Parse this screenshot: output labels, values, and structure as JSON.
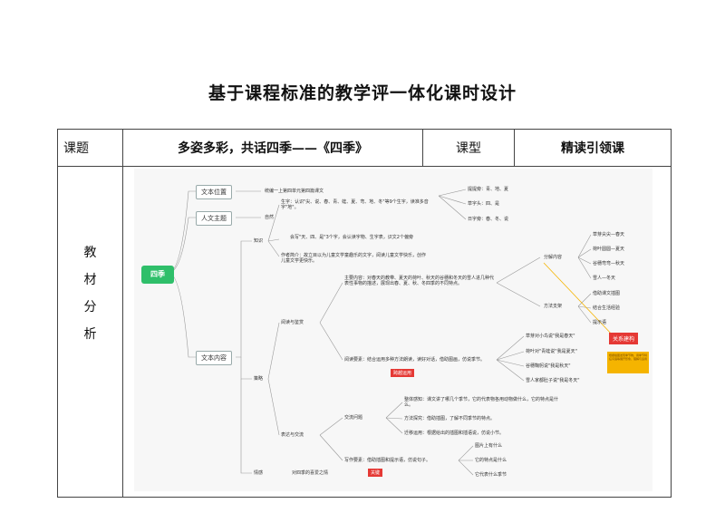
{
  "doc": {
    "title": "基于课程标准的教学评一体化课时设计",
    "lesson_label": "课题",
    "lesson_value": "多姿多彩，共话四季——《四季》",
    "type_label": "课型",
    "type_value": "精读引领课",
    "analysis_label_chars": [
      "教",
      "材",
      "分",
      "析"
    ]
  },
  "mindmap": {
    "root": "四季",
    "branch1": "文本位置",
    "branch1_note": "统编一上第四单元第四篇课文",
    "branch2": "人文主题",
    "branch2_note": "自然",
    "branch3": "文本内容",
    "knowledge": "知识",
    "char_note": "生字：认识\"尖、说、春、青、蛙、夏、弯、地、冬\"等9个生字，读准多音字\"地\"。",
    "radicals": [
      "提提旁：青、地、夏",
      "草字头：四、是",
      "日字旁：春、冬、说"
    ],
    "write_note": "会写\"天、四、是\"3个字，会认读字物、生字表，识文2个偏旁",
    "author_note": "作者简介：故立目以为儿童文学童趣乐的文字，阅读儿童文学快乐，创作儿童文学更快乐。",
    "strategy": "策略",
    "read_feel": "阅读与鉴赏",
    "main_content": "主要内容：对春天的教带、夏天的荷叶、秋天的谷穗和冬天的雪人进几种代表性事物的描述，展现出春、夏、秋、冬四季的不同特点。",
    "read_req": "阅读要素：结合运用多种方法朗读，读好对话，借助图画，仿说季节。",
    "social_share": "表达与交流",
    "exchange": "交流问题",
    "q1": "整体感知：课文讲了哪几个季节，它的代表物各用动物做什么，它的特点是什么。",
    "q2": "方法探究：借助插图，了解不同季节的特点。",
    "q3": "迁移运用：根据给出的插图和插语说，仿说小节。",
    "writing": "写作要素：借助插图和提示语，仿说句子。",
    "w_items": [
      "图片上有什么",
      "它的特点是什么",
      "它代表什么季节"
    ],
    "emotion": "情感",
    "emotion_note": "对四季的喜爱之情",
    "pairs": "分解内容",
    "pair_items": [
      "草芽尖尖—春天",
      "荷叶圆圆—夏天",
      "谷穗弯弯—秋天",
      "雪人—冬天"
    ],
    "method": "方法支架",
    "method_items": [
      "借助课文插图",
      "结合生活经验",
      "提示语"
    ],
    "read_items": [
      "草芽对小鸟说\"我是春天\"",
      "荷叶对\"青蛙说\"我是夏天\"",
      "谷穗鞠躬说\"我是秋天\"",
      "雪人家都肚子说\"我是冬天\""
    ],
    "tag_core": "关系建构",
    "tag_red1": "跨越运用",
    "tag_red2": "关键",
    "yellow_note": "根据插图发现季节物，用季节特征词语等展开形象，理解与运用"
  }
}
